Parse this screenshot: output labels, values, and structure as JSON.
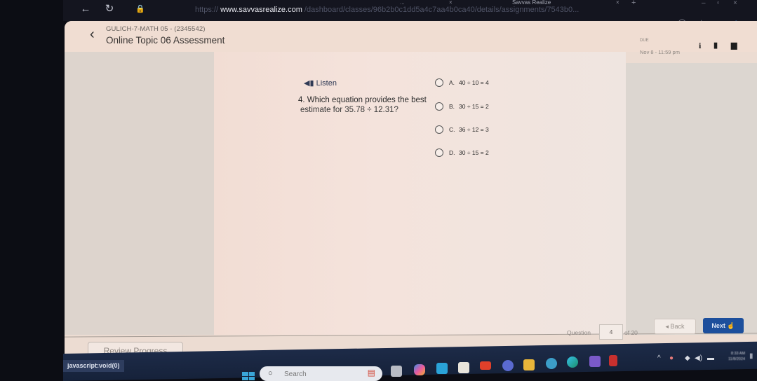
{
  "browser": {
    "url_scheme": "https://",
    "url_host": "www.savvasrealize.com",
    "url_path": "/dashboard/classes/96b2b0c1dd5a4c7aa4b0ca40/details/assignments/7543b0...",
    "tabs": [
      {
        "label": "...",
        "close": "×"
      },
      {
        "label": "Savvas Realize",
        "close": "×"
      }
    ],
    "new_tab": "+",
    "window_controls": {
      "minimize": "–",
      "maximize": "▫",
      "close": "×"
    },
    "icons": {
      "back": "back-arrow-icon",
      "reload": "reload-icon",
      "lock": "lock-icon"
    }
  },
  "header": {
    "course": "GULICH-7-MATH 05 - (2345542)",
    "title": "Online Topic 06 Assessment",
    "due_label": "DUE",
    "due_date": "Nov 8 - 11:59 pm",
    "icons": [
      "info-icon",
      "notebook-icon",
      "comment-icon"
    ]
  },
  "question": {
    "listen_label": "Listen",
    "number": "4.",
    "text_line1": "Which equation provides the best",
    "text_line2": "estimate for 35.78 ÷ 12.31?",
    "choices": [
      {
        "letter": "A.",
        "text": "40 ÷ 10 = 4"
      },
      {
        "letter": "B.",
        "text": "30 ÷ 15 = 2"
      },
      {
        "letter": "C.",
        "text": "36 ÷ 12 = 3"
      },
      {
        "letter": "D.",
        "text": "30 ÷ 15 = 2"
      }
    ]
  },
  "footer": {
    "question_label": "Question",
    "current_question": "4",
    "of_total": "of 20",
    "back_label": "◂ Back",
    "next_label": "Next",
    "review_label": "Review Progress"
  },
  "status_bar": {
    "link_text": "javascript:void(0)"
  },
  "taskbar": {
    "search_placeholder": "Search",
    "apps": [
      "task-view",
      "copilot",
      "mdp",
      "calendar",
      "youtube",
      "teams",
      "file-explorer",
      "help",
      "edge",
      "media",
      "mcafee"
    ],
    "clock_time": "8:33 AM",
    "clock_date": "11/8/2024"
  }
}
